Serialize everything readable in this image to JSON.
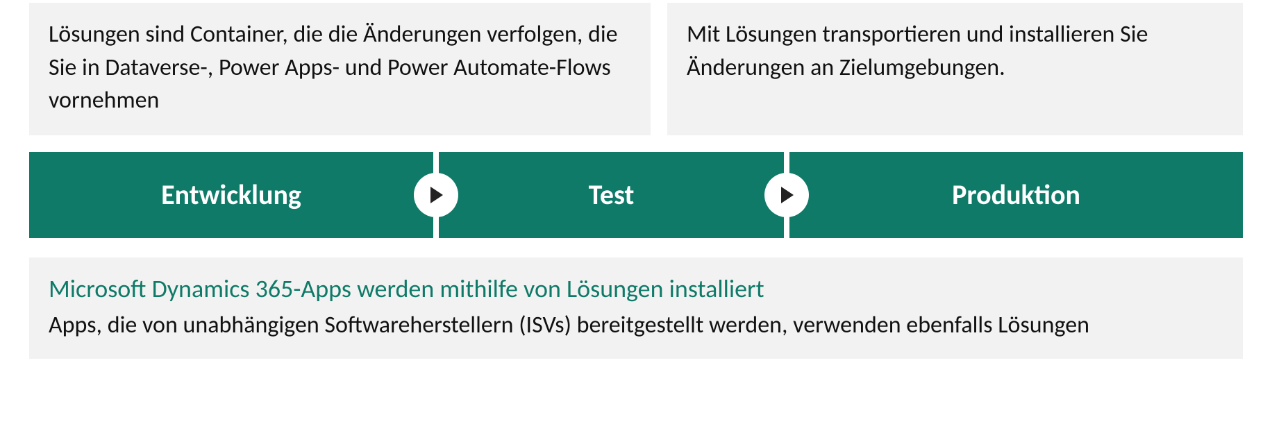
{
  "info_boxes": {
    "left": "Lösungen sind Container, die die Änderungen verfolgen, die Sie in Dataverse-, Power Apps- und Power Automate-Flows vornehmen",
    "right": "Mit Lösungen transportieren und installieren Sie Änderungen an Zielumgebungen."
  },
  "stages": {
    "s1": "Entwicklung",
    "s2": "Test",
    "s3": "Produktion"
  },
  "bottom": {
    "headline": "Microsoft Dynamics 365-Apps werden mithilfe von Lösungen installiert",
    "subline": "Apps, die von unabhängigen Softwareherstellern (ISVs) bereitgestellt werden, verwenden ebenfalls Lösungen"
  },
  "colors": {
    "teal": "#0f7a68",
    "grey": "#f2f2f2"
  }
}
